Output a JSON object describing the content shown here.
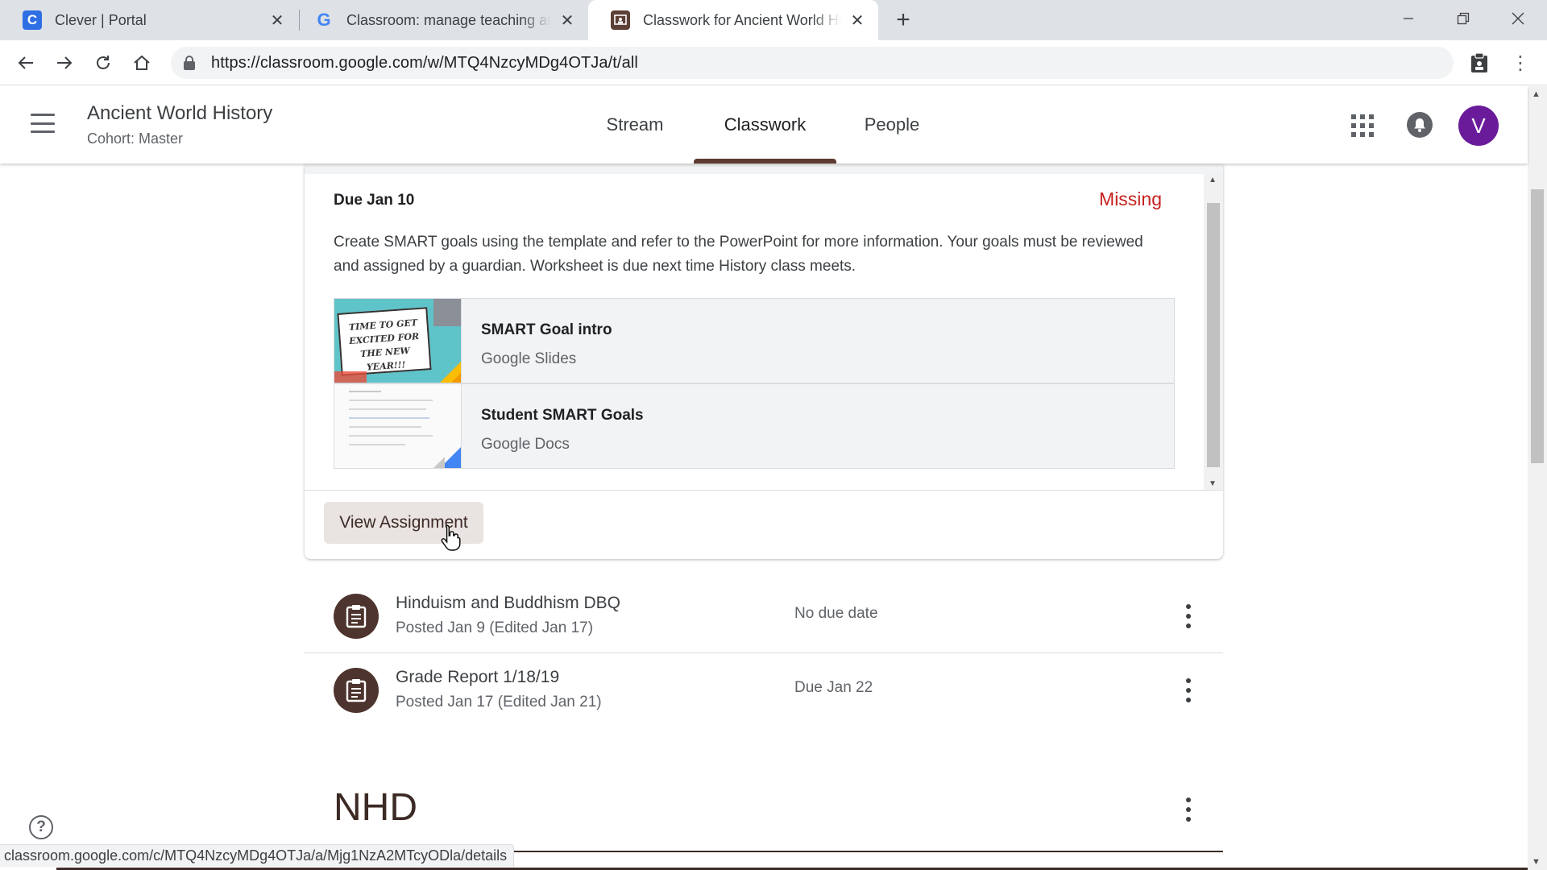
{
  "browser": {
    "tabs": [
      {
        "title": "Clever | Portal",
        "favicon": "clever-c-icon",
        "favicon_letter": "C",
        "active": false
      },
      {
        "title": "Classroom: manage teaching and learning",
        "favicon": "google-g-icon",
        "favicon_letter": "G",
        "active": false
      },
      {
        "title": "Classwork for Ancient World History",
        "favicon": "classroom-icon",
        "favicon_letter": "",
        "active": true
      }
    ],
    "url": "https://classroom.google.com/w/MTQ4NzcyMDg4OTJa/t/all",
    "status_url": "classroom.google.com/c/MTQ4NzcyMDg4OTJa/a/Mjg1NzA2MTcyODla/details"
  },
  "header": {
    "class_name": "Ancient World History",
    "cohort": "Cohort: Master",
    "tabs": [
      "Stream",
      "Classwork",
      "People"
    ],
    "active_tab": "Classwork",
    "avatar_letter": "V"
  },
  "assignment": {
    "due": "Due Jan 10",
    "status": "Missing",
    "description": "Create SMART goals using the template and refer to the PowerPoint for more information. Your goals must be reviewed and assigned by a guardian. Worksheet is due next time History class meets.",
    "attachments": [
      {
        "name": "SMART Goal intro",
        "type": "Google Slides",
        "thumb_text": "TIME TO GET EXCITED FOR THE NEW YEAR!!!"
      },
      {
        "name": "Student SMART Goals",
        "type": "Google Docs"
      }
    ],
    "view_button": "View Assignment"
  },
  "classwork_items": [
    {
      "title": "Hinduism and Buddhism DBQ",
      "posted": "Posted Jan 9 (Edited Jan 17)",
      "due": "No due date"
    },
    {
      "title": "Grade Report 1/18/19",
      "posted": "Posted Jan 17 (Edited Jan 21)",
      "due": "Due Jan 22"
    }
  ],
  "topic": {
    "title": "NHD"
  },
  "colors": {
    "accent": "#5d3a2f",
    "missing": "#c5221f",
    "avatar": "#6a1b9a",
    "item_icon_bg": "#4e342e"
  }
}
